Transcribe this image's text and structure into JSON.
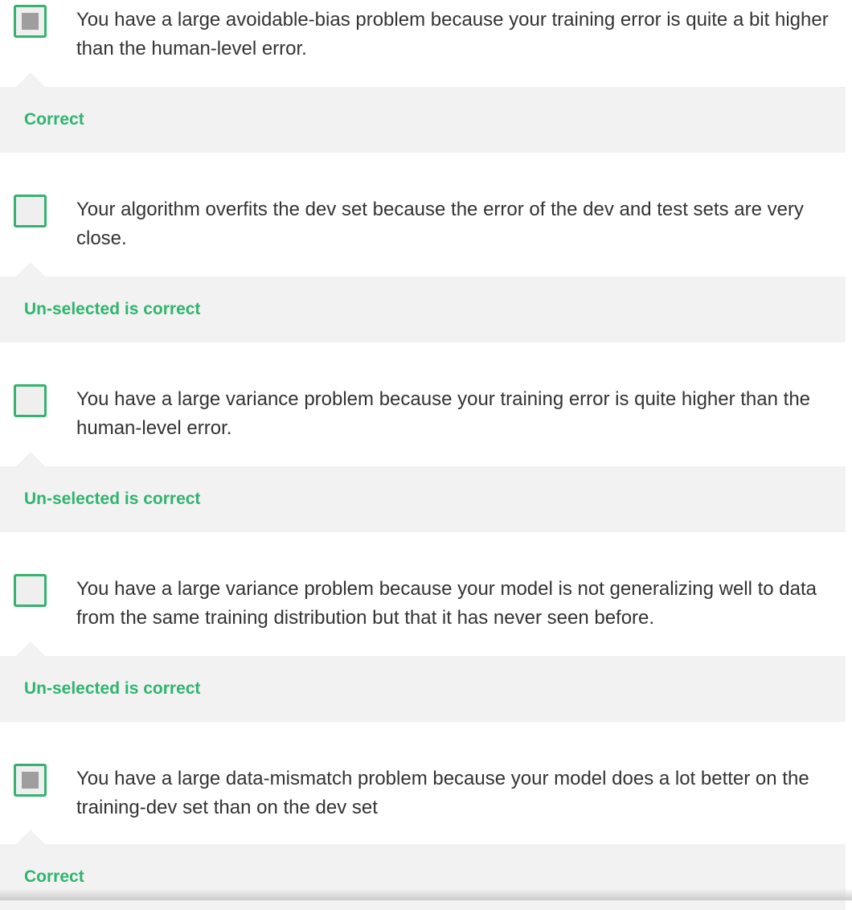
{
  "options": [
    {
      "text": "You have a large avoidable-bias problem because your training error is quite a bit higher than the human-level error.",
      "checked": true,
      "feedback": "Correct"
    },
    {
      "text": "Your algorithm overfits the dev set because the error of the dev and test sets are very close.",
      "checked": false,
      "feedback": "Un-selected is correct"
    },
    {
      "text": "You have a large variance problem because your training error is quite higher than the human-level error.",
      "checked": false,
      "feedback": "Un-selected is correct"
    },
    {
      "text": "You have a large variance problem because your model is not generalizing well to data from the same training distribution but that it has never seen before.",
      "checked": false,
      "feedback": "Un-selected is correct"
    },
    {
      "text": "You have a large data-mismatch problem because your model does a lot better on the training-dev set than on the dev set",
      "checked": true,
      "feedback": "Correct"
    }
  ],
  "colors": {
    "accent_green": "#2fb56d",
    "checkbox_border": "#35b26f",
    "feedback_bg": "#f2f2f2",
    "checked_fill": "#9e9e9e"
  }
}
